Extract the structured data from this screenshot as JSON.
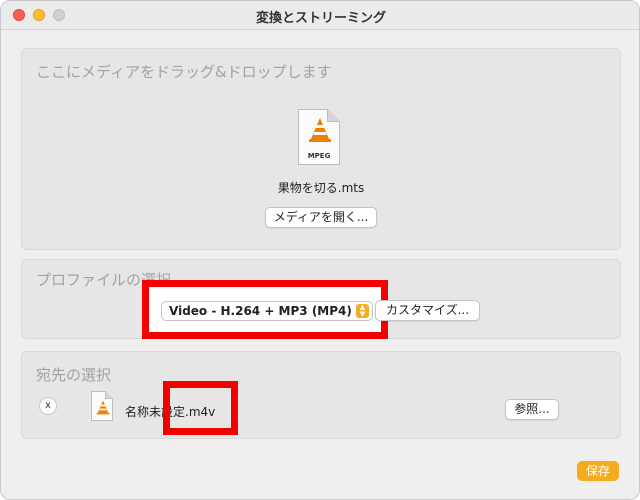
{
  "window": {
    "title": "変換とストリーミング"
  },
  "drop_area": {
    "title": "ここにメディアをドラッグ&ドロップします",
    "file_icon_label": "MPEG",
    "filename": "果物を切る.mts",
    "open_button": "メディアを開く..."
  },
  "profile": {
    "title": "プロファイルの選択",
    "selected": "Video - H.264 + MP3 (MP4)",
    "customize_button": "カスタマイズ..."
  },
  "destination": {
    "title": "宛先の選択",
    "remove_label": "x",
    "filename": "名称未設定.m4v",
    "browse_button": "参照..."
  },
  "footer": {
    "save_button": "保存"
  },
  "colors": {
    "accent": "#f5ad1f",
    "highlight": "#f40000",
    "vlc_cone": "#f07d00"
  },
  "icons": {
    "file": "vlc-media-file-icon",
    "select_arrows": "updown-chevron-icon"
  }
}
